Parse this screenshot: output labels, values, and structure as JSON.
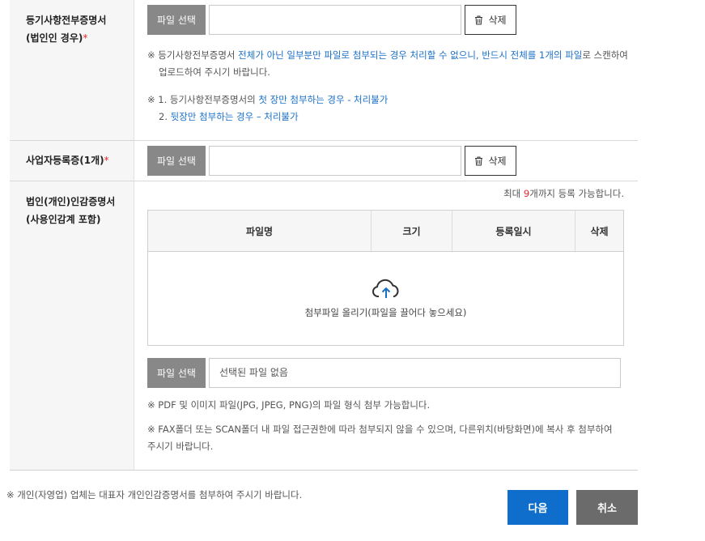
{
  "registry": {
    "label_line1": "등기사항전부증명서",
    "label_line2": "(법인인 경우)",
    "required_mark": "*",
    "file_button": "파일 선택",
    "delete_button": "삭제",
    "note1_prefix": "※ 등기사항전부증명서 ",
    "note1_blue1": "전체가 아닌 일부분만 파일로 첨부되는 경우 처리할 수 없으니, 반드시 전체를 1개의 파일",
    "note1_suffix": "로 스캔하여",
    "note1_line2": "업로드하여 주시기 바랍니다.",
    "note2_prefix": "※ 1. 등기사항전부증명서의 ",
    "note2_blue": "첫 장만 첨부하는 경우 - 처리불가",
    "note3_prefix": "2. ",
    "note3_blue": "뒷장만 첨부하는 경우 – 처리불가"
  },
  "business": {
    "label": "사업자등록증(1개)",
    "required_mark": "*",
    "file_button": "파일 선택",
    "delete_button": "삭제"
  },
  "seal": {
    "label_line1": "법인(개인)인감증명서",
    "label_line2": "(사용인감계 포함)",
    "limit_prefix": "최대 ",
    "limit_count": "9",
    "limit_suffix": "개까지 등록 가능합니다.",
    "columns": [
      "파일명",
      "크기",
      "등록일시",
      "삭제"
    ],
    "dropzone_text": "첨부파일 올리기(파일을 끌어다 놓으세요)",
    "file_button": "파일 선택",
    "no_file_text": "선택된 파일 없음",
    "note1": "※ PDF 및 이미지 파일(JPG, JPEG, PNG)의 파일 형식 첨부 가능합니다.",
    "note2_line1": "※ FAX폴더 또는 SCAN폴더 내 파일 접근권한에 따라 첨부되지 않을 수 있으며, 다른위치(바탕화면)에 복사 후 첨부하여",
    "note2_line2": "주시기 바랍니다."
  },
  "footer": {
    "note": "※ 개인(자영업) 업체는 대표자 개인인감증명서를 첨부하여 주시기 바랍니다.",
    "next_button": "다음",
    "cancel_button": "취소"
  },
  "colors": {
    "accent": "#0f6dcb",
    "required": "#e6262a",
    "link_blue": "#1a6fc7"
  }
}
